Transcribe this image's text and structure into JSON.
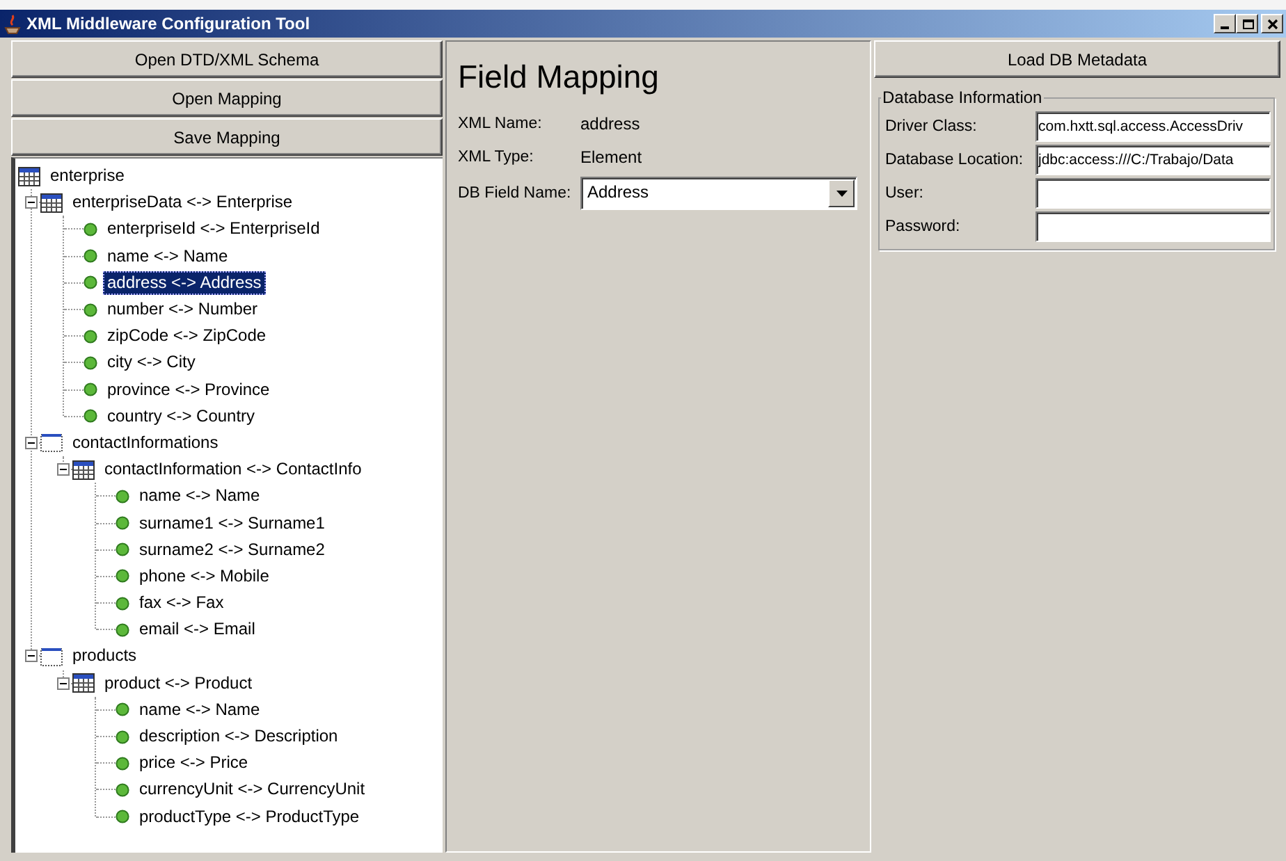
{
  "window": {
    "title": "XML Middleware Configuration Tool"
  },
  "left_panel": {
    "buttons": [
      "Open DTD/XML Schema",
      "Open Mapping",
      "Save Mapping"
    ],
    "tree": [
      {
        "label": "enterprise",
        "kind": "table",
        "selected": false,
        "children": [
          {
            "label": "enterpriseData <-> Enterprise",
            "kind": "table",
            "expanded": true,
            "selected": false,
            "children": [
              {
                "label": "enterpriseId <-> EnterpriseId",
                "kind": "field",
                "selected": false
              },
              {
                "label": "name <-> Name",
                "kind": "field",
                "selected": false
              },
              {
                "label": "address <-> Address",
                "kind": "field",
                "selected": true
              },
              {
                "label": "number <-> Number",
                "kind": "field",
                "selected": false
              },
              {
                "label": "zipCode <-> ZipCode",
                "kind": "field",
                "selected": false
              },
              {
                "label": "city <-> City",
                "kind": "field",
                "selected": false
              },
              {
                "label": "province <-> Province",
                "kind": "field",
                "selected": false
              },
              {
                "label": "country <-> Country",
                "kind": "field",
                "selected": false
              }
            ]
          },
          {
            "label": "contactInformations",
            "kind": "group",
            "expanded": true,
            "selected": false,
            "children": [
              {
                "label": "contactInformation <-> ContactInfo",
                "kind": "table",
                "expanded": true,
                "selected": false,
                "children": [
                  {
                    "label": "name <-> Name",
                    "kind": "field",
                    "selected": false
                  },
                  {
                    "label": "surname1 <-> Surname1",
                    "kind": "field",
                    "selected": false
                  },
                  {
                    "label": "surname2 <-> Surname2",
                    "kind": "field",
                    "selected": false
                  },
                  {
                    "label": "phone <-> Mobile",
                    "kind": "field",
                    "selected": false
                  },
                  {
                    "label": "fax <-> Fax",
                    "kind": "field",
                    "selected": false
                  },
                  {
                    "label": "email <-> Email",
                    "kind": "field",
                    "selected": false
                  }
                ]
              }
            ]
          },
          {
            "label": "products",
            "kind": "group",
            "expanded": true,
            "selected": false,
            "children": [
              {
                "label": "product <-> Product",
                "kind": "table",
                "expanded": true,
                "selected": false,
                "children": [
                  {
                    "label": "name <-> Name",
                    "kind": "field",
                    "selected": false
                  },
                  {
                    "label": "description <-> Description",
                    "kind": "field",
                    "selected": false
                  },
                  {
                    "label": "price <-> Price",
                    "kind": "field",
                    "selected": false
                  },
                  {
                    "label": "currencyUnit <-> CurrencyUnit",
                    "kind": "field",
                    "selected": false
                  },
                  {
                    "label": "productType <-> ProductType",
                    "kind": "field",
                    "selected": false
                  }
                ]
              }
            ]
          }
        ]
      }
    ]
  },
  "field_mapping": {
    "title": "Field Mapping",
    "rows": [
      {
        "label": "XML Name:",
        "value": "address"
      },
      {
        "label": "XML Type:",
        "value": "Element"
      }
    ],
    "db_field": {
      "label": "DB Field Name:",
      "value": "Address"
    }
  },
  "database_panel": {
    "button": "Load DB Metadata",
    "group_title": "Database Information",
    "fields": [
      {
        "label": "Driver Class:",
        "value": "com.hxtt.sql.access.AccessDriv"
      },
      {
        "label": "Database Location:",
        "value": "jdbc:access:///C:/Trabajo/Data"
      },
      {
        "label": "User:"
      },
      {
        "label": "Password:"
      }
    ]
  }
}
